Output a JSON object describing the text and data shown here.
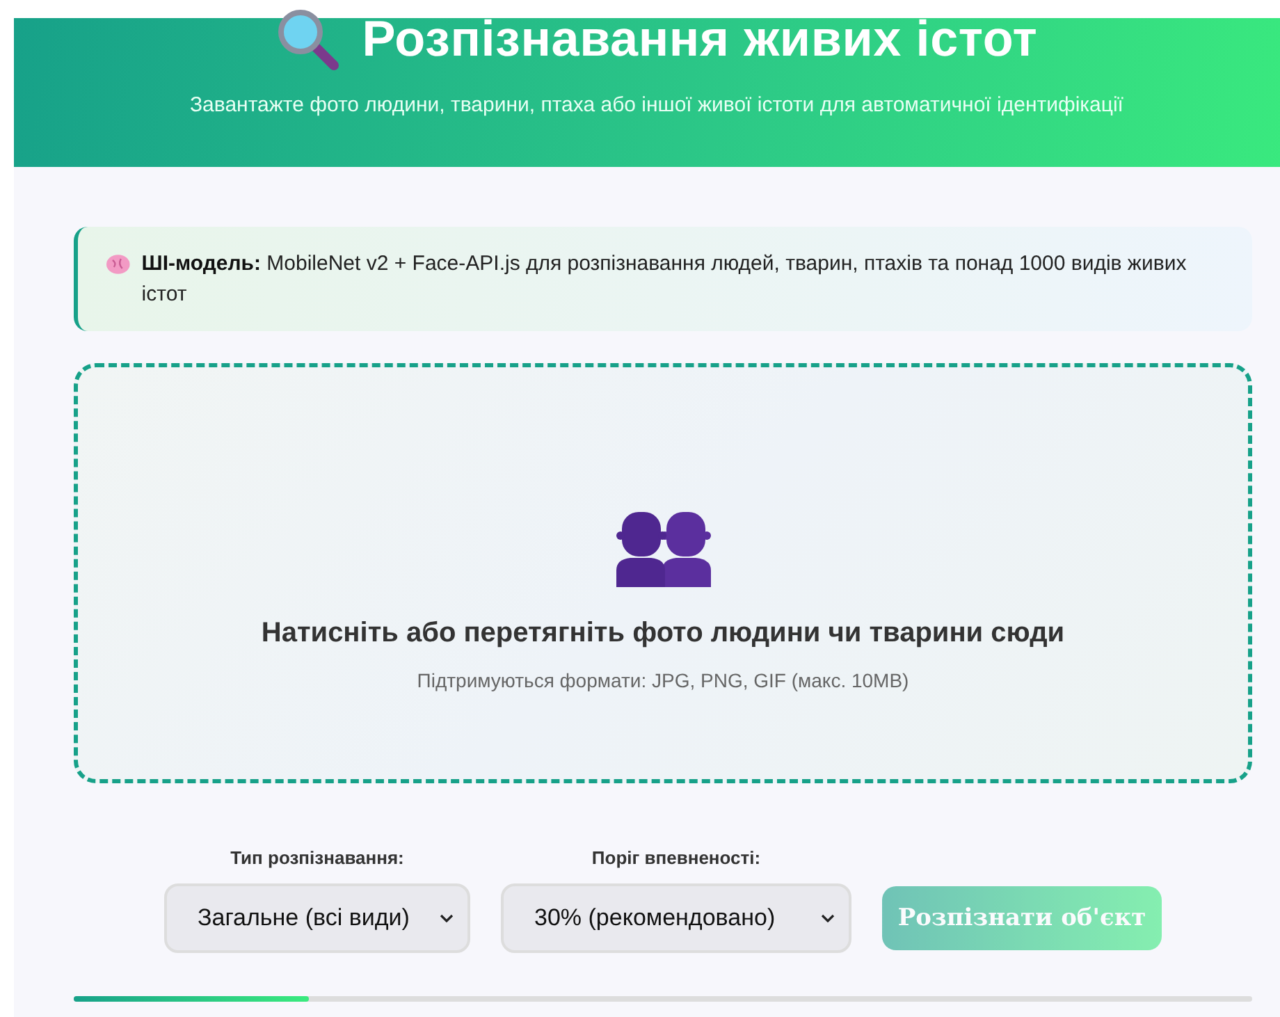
{
  "header": {
    "title": "Розпізнавання живих істот",
    "subtitle": "Завантажте фото людини, тварини, птаха або іншої живої істоти для автоматичної ідентифікації"
  },
  "info": {
    "text": "**ШІ-модель:** MobileNet v2 + Face-API.js для розпізнавання людей, тварин, птахів та понад 1000 видів живих істот"
  },
  "upload": {
    "title": "Натисніть або перетягніть фото людини чи тварини сюди",
    "hint": "Підтримуються формати: JPG, PNG, GIF (макс. 10MB)"
  },
  "controls": [
    {
      "label": "Тип розпізнавання:",
      "value": "Загальне (всі види)"
    },
    {
      "label": "Поріг впевненості:",
      "value": "30% (рекомендовано)"
    }
  ],
  "button": {
    "label": "Розпізнати об'єкт",
    "disabled": true
  },
  "progress": {
    "level": 0.2
  }
}
